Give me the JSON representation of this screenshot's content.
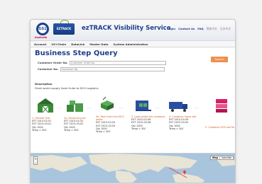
{
  "header": {
    "gs1_logo": "GS1",
    "gs1_sub": "Australia",
    "ez_logo": "EZTRACK",
    "title": "ezTRACK Visibility Service",
    "links": [
      "Login",
      "Contact Us",
      "FAQ"
    ],
    "lang_links": [
      "简体中文",
      "日本中文"
    ]
  },
  "nav": [
    "Account",
    "VS+Chain",
    "DataLink",
    "Master Data",
    "System Administration"
  ],
  "page": {
    "title": "Business Step Query",
    "customer_order_label": "Customer Order No.",
    "customer_order_placeholder": "Customer Order No.",
    "container_label": "Container No.",
    "container_placeholder": "Container No.",
    "search_label": "Search",
    "description_heading": "Description",
    "description_text": "Fresh world supply fresh fruits to DCH Logistics"
  },
  "steps": [
    {
      "title": "1. Harvest fruit",
      "est": "EST 2015-03-01",
      "evt": "EVT 2015-03-01",
      "qty": "Qty 1000",
      "temp": "Temp > 30C",
      "icon": "barn-icon"
    },
    {
      "title": "2a. Devanning bin",
      "est": "EST 2015-03-02",
      "evt": "EVT 2015-03-02",
      "qty": "Qty 1000",
      "temp": "Temp > 30C",
      "icon": "bins-icon"
    },
    {
      "title": "2b. Pack fruit into SSCC pallet",
      "est": "EST 2015-03-03",
      "evt": "EVT 2015-03-03",
      "qty": "Qty 1000",
      "temp": "Temp > 30C",
      "icon": "pallet-box-icon"
    },
    {
      "title": "3. Load pallet into container",
      "est": "EST 2015-03-06",
      "evt": "EVT 2015-03-06",
      "qty": "Qty 1000",
      "temp": "Temp > 30C",
      "icon": "container-load-icon"
    },
    {
      "title": "4. Container leave site",
      "est": "EST 2015-03-09",
      "evt": "EVT 2015-03-09",
      "qty": "Qty 1000",
      "temp": "Temp > 30C",
      "icon": "truck-icon"
    },
    {
      "title": "5. Container DCH tanTia",
      "est": "",
      "evt": "",
      "qty": "",
      "temp": "",
      "icon": "container-stack-icon"
    }
  ],
  "map": {
    "zoom_buttons": [
      "+",
      "−"
    ],
    "types": [
      "Map",
      "Satellite"
    ]
  }
}
